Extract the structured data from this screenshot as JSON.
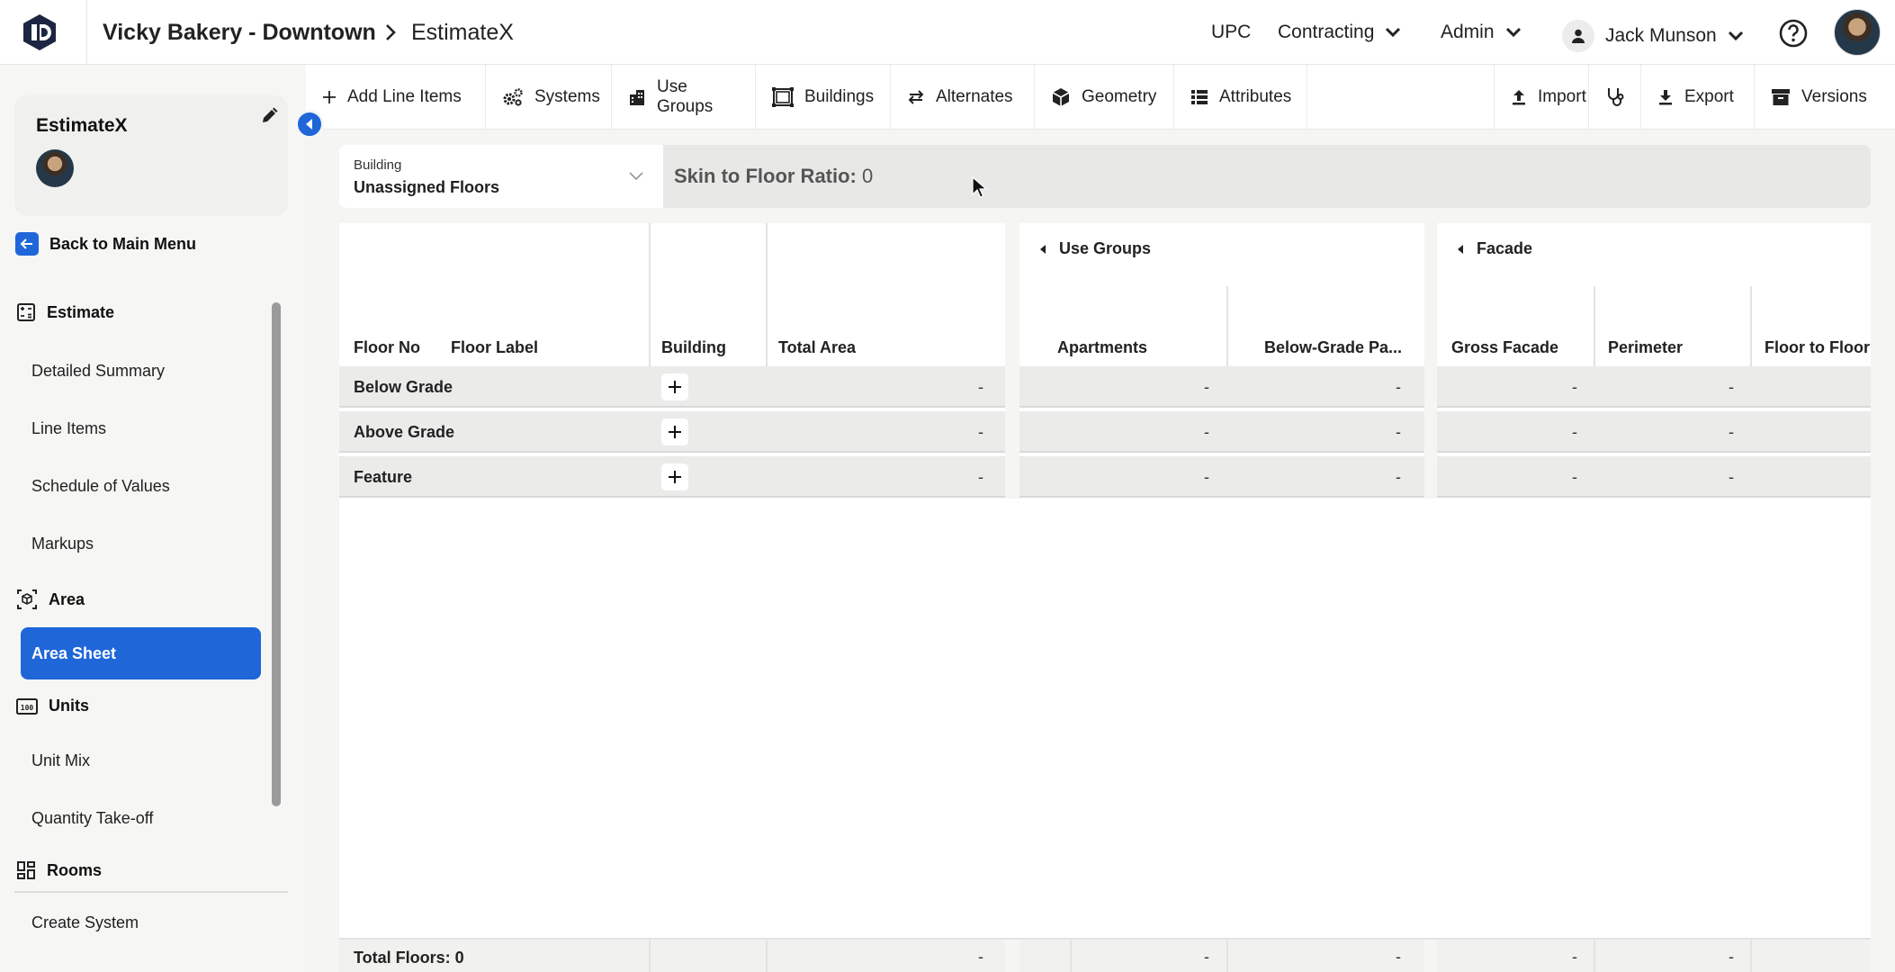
{
  "header": {
    "project_title": "Vicky Bakery - Downtown",
    "current_app": "EstimateX",
    "nav_upc": "UPC",
    "nav_contracting": "Contracting",
    "nav_admin": "Admin",
    "user_name": "Jack Munson"
  },
  "sidebar": {
    "app_name": "EstimateX",
    "back_label": "Back to Main Menu",
    "sections": {
      "estimate": "Estimate",
      "area": "Area",
      "units": "Units",
      "rooms": "Rooms"
    },
    "items": {
      "detailed_summary": "Detailed Summary",
      "line_items": "Line Items",
      "schedule_of_values": "Schedule of Values",
      "markups": "Markups",
      "area_sheet": "Area Sheet",
      "unit_mix": "Unit Mix",
      "quantity_takeoff": "Quantity Take-off",
      "create_system": "Create System"
    }
  },
  "toolbar": {
    "add_line_items": "Add Line Items",
    "systems": "Systems",
    "use_groups": "Use Groups",
    "buildings": "Buildings",
    "alternates": "Alternates",
    "geometry": "Geometry",
    "attributes": "Attributes",
    "import": "Import",
    "export": "Export",
    "versions": "Versions"
  },
  "filter": {
    "building_label": "Building",
    "building_value": "Unassigned Floors",
    "ratio_label": "Skin to Floor Ratio:",
    "ratio_value": "0"
  },
  "table": {
    "columns": {
      "floor_no": "Floor No",
      "floor_label": "Floor Label",
      "building": "Building",
      "total_area": "Total Area",
      "apartments": "Apartments",
      "below_grade": "Below-Grade Pa...",
      "gross_facade": "Gross Facade",
      "perimeter": "Perimeter",
      "floor_to_floor": "Floor to Floor"
    },
    "groups": {
      "use_groups": "Use Groups",
      "facade": "Facade"
    },
    "rows": [
      {
        "label": "Below Grade",
        "total_area": "-",
        "apartments": "-",
        "below_grade": "-",
        "gross_facade": "-",
        "perimeter": "-"
      },
      {
        "label": "Above Grade",
        "total_area": "-",
        "apartments": "-",
        "below_grade": "-",
        "gross_facade": "-",
        "perimeter": "-"
      },
      {
        "label": "Feature",
        "total_area": "-",
        "apartments": "-",
        "below_grade": "-",
        "gross_facade": "-",
        "perimeter": "-"
      }
    ],
    "footer": {
      "total_floors": "Total Floors: 0",
      "total_area": "-",
      "apartments": "-",
      "below_grade": "-",
      "gross_facade": "-",
      "perimeter": "-"
    }
  },
  "colors": {
    "accent": "#1f66d9"
  }
}
